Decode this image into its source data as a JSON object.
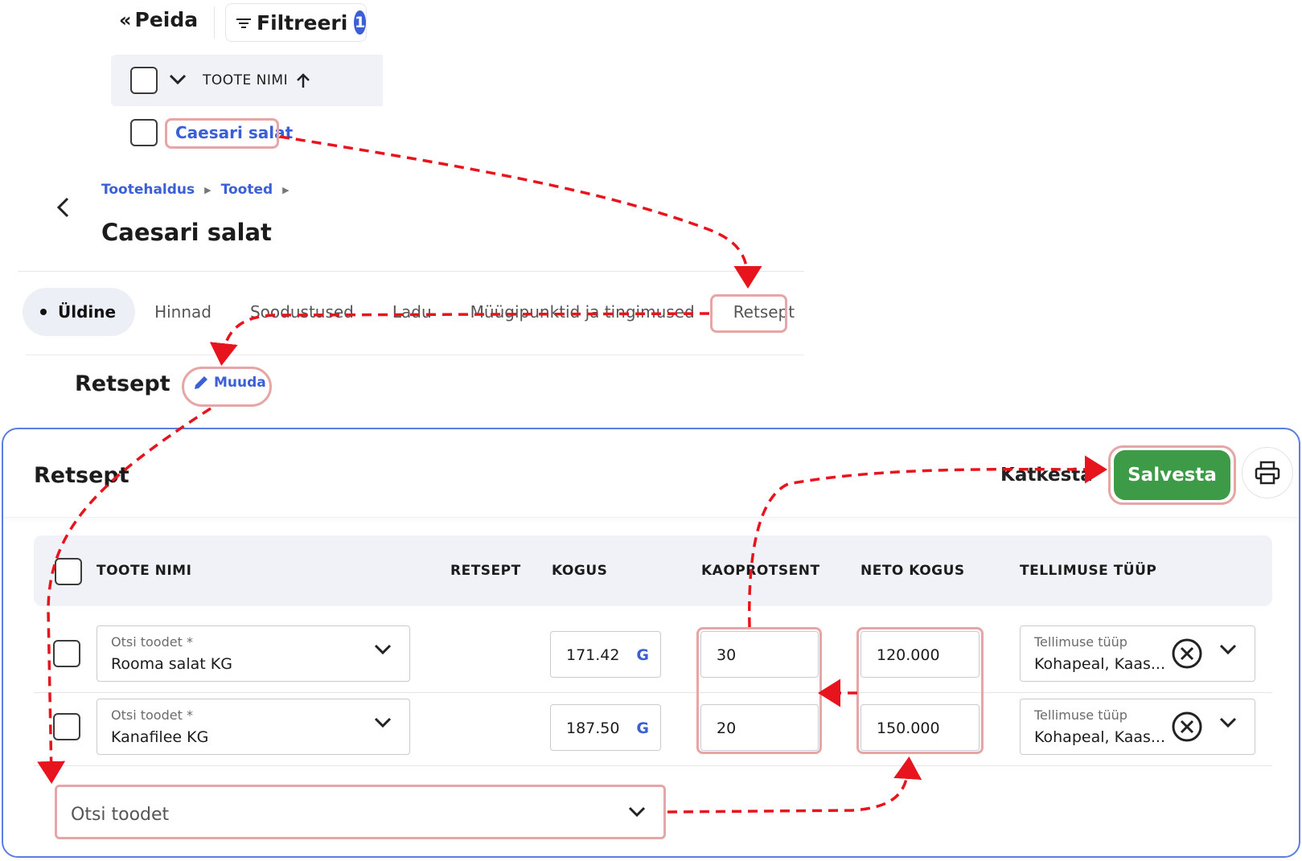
{
  "toolbar": {
    "hide_label": "Peida",
    "filter_label": "Filtreeri",
    "filter_count": "1"
  },
  "product_list": {
    "column_header": "TOOTE NIMI",
    "rows": [
      {
        "name": "Caesari salat"
      }
    ]
  },
  "breadcrumb": [
    "Tootehaldus",
    "Tooted"
  ],
  "page_title": "Caesari salat",
  "tabs": [
    {
      "label": "Üldine",
      "active": true
    },
    {
      "label": "Hinnad"
    },
    {
      "label": "Soodustused"
    },
    {
      "label": "Ladu"
    },
    {
      "label": "Müügipunktid ja tingimused"
    },
    {
      "label": "Retsept"
    }
  ],
  "recipe_section": {
    "title": "Retsept",
    "edit_label": "Muuda"
  },
  "recipe_panel": {
    "title": "Retsept",
    "cancel_label": "Katkesta",
    "save_label": "Salvesta",
    "columns": [
      "TOOTE NIMI",
      "RETSEPT",
      "KOGUS",
      "KAOPROTSENT",
      "NETO KOGUS",
      "TELLIMUSE TÜÜP"
    ],
    "rows": [
      {
        "product_label": "Otsi toodet *",
        "product": "Rooma salat KG",
        "quantity": "171.42",
        "unit": "G",
        "loss_percent": "30",
        "net_quantity": "120.000",
        "order_type_label": "Tellimuse tüüp",
        "order_type": "Kohapeal, Kaas..."
      },
      {
        "product_label": "Otsi toodet *",
        "product": "Kanafilee KG",
        "quantity": "187.50",
        "unit": "G",
        "loss_percent": "20",
        "net_quantity": "150.000",
        "order_type_label": "Tellimuse tüüp",
        "order_type": "Kohapeal, Kaas..."
      }
    ],
    "search_placeholder": "Otsi toodet"
  },
  "colors": {
    "accent_blue": "#3a5fd6",
    "save_green": "#3d9a47",
    "highlight": "#e6a6a6",
    "arrow_red": "#e8141d"
  }
}
